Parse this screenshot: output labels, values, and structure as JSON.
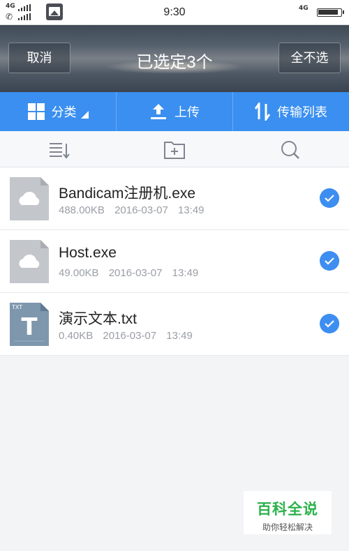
{
  "status_bar": {
    "network_label_1": "4G",
    "network_label_2": "4G",
    "time": "9:30",
    "icons": [
      "signal-icon",
      "phone-icon",
      "gallery-icon",
      "battery-icon"
    ]
  },
  "header": {
    "cancel_label": "取消",
    "title": "已选定3个",
    "deselect_all_label": "全不选"
  },
  "toolbar": {
    "category_label": "分类",
    "upload_label": "上传",
    "transfer_list_label": "传输列表"
  },
  "iconbar": {
    "icons": [
      "sort-list-icon",
      "new-folder-icon",
      "search-icon"
    ]
  },
  "files": [
    {
      "name": "Bandicam注册机.exe",
      "size": "488.00KB",
      "date": "2016-03-07",
      "time": "13:49",
      "icon": "cloud-file-icon",
      "selected": true
    },
    {
      "name": "Host.exe",
      "size": "49.00KB",
      "date": "2016-03-07",
      "time": "13:49",
      "icon": "cloud-file-icon",
      "selected": true
    },
    {
      "name": "演示文本.txt",
      "size": "0.40KB",
      "date": "2016-03-07",
      "time": "13:49",
      "icon": "txt-file-icon",
      "selected": true
    }
  ],
  "txt_badge": "TXT",
  "txt_letter": "T",
  "watermark": {
    "title": "百科全说",
    "subtitle": "助你轻松解决"
  },
  "colors": {
    "accent": "#3a8ff0",
    "check": "#3d8ef0",
    "watermark": "#2bb24c"
  }
}
